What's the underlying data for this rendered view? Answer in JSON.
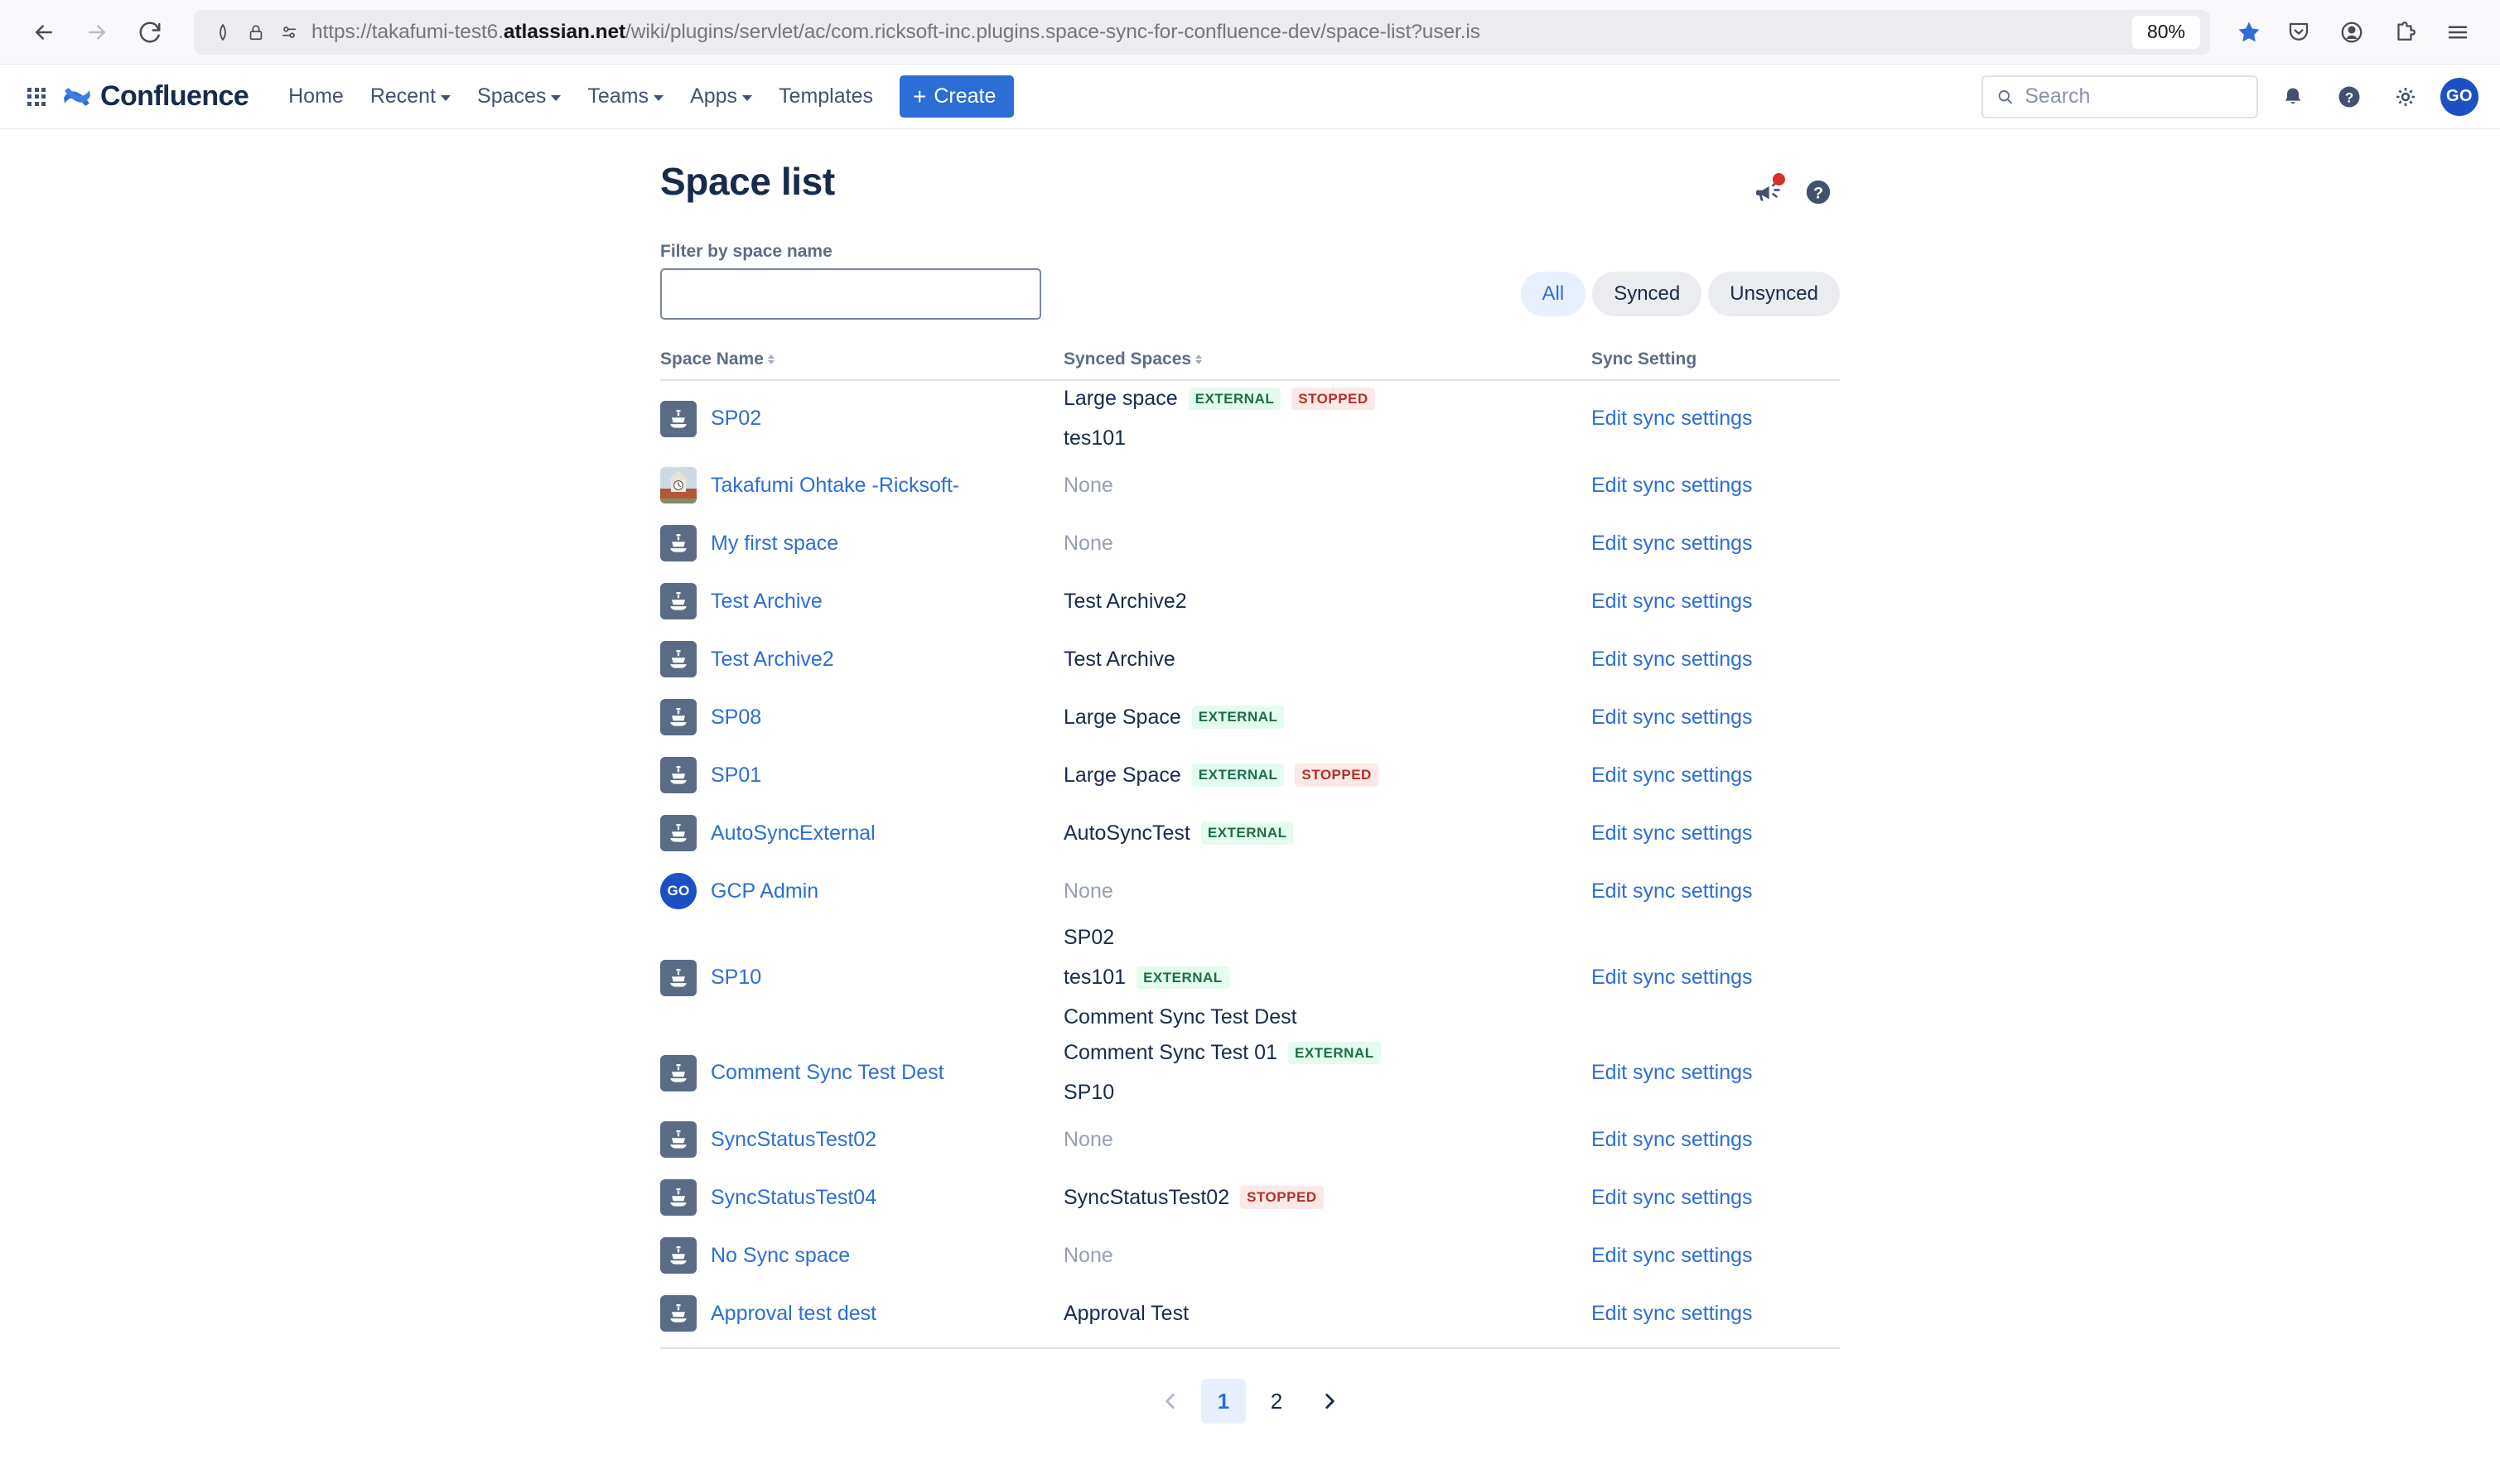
{
  "browser": {
    "url_prefix": "https://takafumi-test6.",
    "url_domain": "atlassian.net",
    "url_suffix": "/wiki/plugins/servlet/ac/com.ricksoft-inc.plugins.space-sync-for-confluence-dev/space-list?user.is",
    "zoom_level": "80%"
  },
  "confluence_nav": {
    "logo_text": "Confluence",
    "items": [
      {
        "label": "Home",
        "has_caret": false
      },
      {
        "label": "Recent",
        "has_caret": true
      },
      {
        "label": "Spaces",
        "has_caret": true
      },
      {
        "label": "Teams",
        "has_caret": true
      },
      {
        "label": "Apps",
        "has_caret": true
      },
      {
        "label": "Templates",
        "has_caret": false
      }
    ],
    "create_label": "Create",
    "search_placeholder": "Search",
    "avatar_initials": "GO"
  },
  "page": {
    "title": "Space list",
    "filter_label": "Filter by space name",
    "filter_value": "",
    "filter_placeholder": "",
    "segments": [
      {
        "label": "All",
        "active": true
      },
      {
        "label": "Synced",
        "active": false
      },
      {
        "label": "Unsynced",
        "active": false
      }
    ]
  },
  "table": {
    "headers": {
      "space_name": "Space Name",
      "synced_spaces": "Synced Spaces",
      "sync_setting": "Sync Setting"
    },
    "edit_link_label": "Edit sync settings",
    "none_label": "None",
    "rows": [
      {
        "name": "SP02",
        "icon": "space-ship-icon",
        "synced": [
          {
            "text": "Large space",
            "tags": [
              "EXTERNAL",
              "STOPPED"
            ]
          },
          {
            "text": "tes101",
            "tags": []
          }
        ]
      },
      {
        "name": "Takafumi Ohtake -Ricksoft-",
        "icon": "user-photo-avatar",
        "synced": []
      },
      {
        "name": "My first space",
        "icon": "space-ship-icon",
        "synced": []
      },
      {
        "name": "Test Archive",
        "icon": "space-ship-icon",
        "synced": [
          {
            "text": "Test Archive2",
            "tags": []
          }
        ]
      },
      {
        "name": "Test Archive2",
        "icon": "space-ship-icon",
        "synced": [
          {
            "text": "Test Archive",
            "tags": []
          }
        ]
      },
      {
        "name": "SP08",
        "icon": "space-ship-icon",
        "synced": [
          {
            "text": "Large Space",
            "tags": [
              "EXTERNAL"
            ]
          }
        ]
      },
      {
        "name": "SP01",
        "icon": "space-ship-icon",
        "synced": [
          {
            "text": "Large Space",
            "tags": [
              "EXTERNAL",
              "STOPPED"
            ]
          }
        ]
      },
      {
        "name": "AutoSyncExternal",
        "icon": "space-ship-icon",
        "synced": [
          {
            "text": "AutoSyncTest",
            "tags": [
              "EXTERNAL"
            ]
          }
        ]
      },
      {
        "name": "GCP Admin",
        "icon": "user-initials-avatar",
        "initials": "GO",
        "synced": []
      },
      {
        "name": "SP10",
        "icon": "space-ship-icon",
        "synced": [
          {
            "text": "SP02",
            "tags": []
          },
          {
            "text": "tes101",
            "tags": [
              "EXTERNAL"
            ]
          },
          {
            "text": "Comment Sync Test Dest",
            "tags": []
          }
        ]
      },
      {
        "name": "Comment Sync Test Dest",
        "icon": "space-ship-icon",
        "synced": [
          {
            "text": "Comment Sync Test 01",
            "tags": [
              "EXTERNAL"
            ]
          },
          {
            "text": "SP10",
            "tags": []
          }
        ]
      },
      {
        "name": "SyncStatusTest02",
        "icon": "space-ship-icon",
        "synced": []
      },
      {
        "name": "SyncStatusTest04",
        "icon": "space-ship-icon",
        "synced": [
          {
            "text": "SyncStatusTest02",
            "tags": [
              "STOPPED"
            ]
          }
        ]
      },
      {
        "name": "No Sync space",
        "icon": "space-ship-icon",
        "synced": []
      },
      {
        "name": "Approval test dest",
        "icon": "space-ship-icon",
        "synced": [
          {
            "text": "Approval Test",
            "tags": []
          }
        ]
      }
    ]
  },
  "pagination": {
    "pages": [
      {
        "label": "1",
        "current": true
      },
      {
        "label": "2",
        "current": false
      }
    ]
  },
  "colors": {
    "brand_blue": "#2c6ed5",
    "link_blue": "#2c6ed5",
    "text_dark": "#172b4d",
    "lozenge_external_bg": "#e3fcef",
    "lozenge_external_fg": "#1b6e47",
    "lozenge_stopped_bg": "#fbe9e7",
    "lozenge_stopped_fg": "#b33025",
    "badge_red": "#d93025"
  }
}
